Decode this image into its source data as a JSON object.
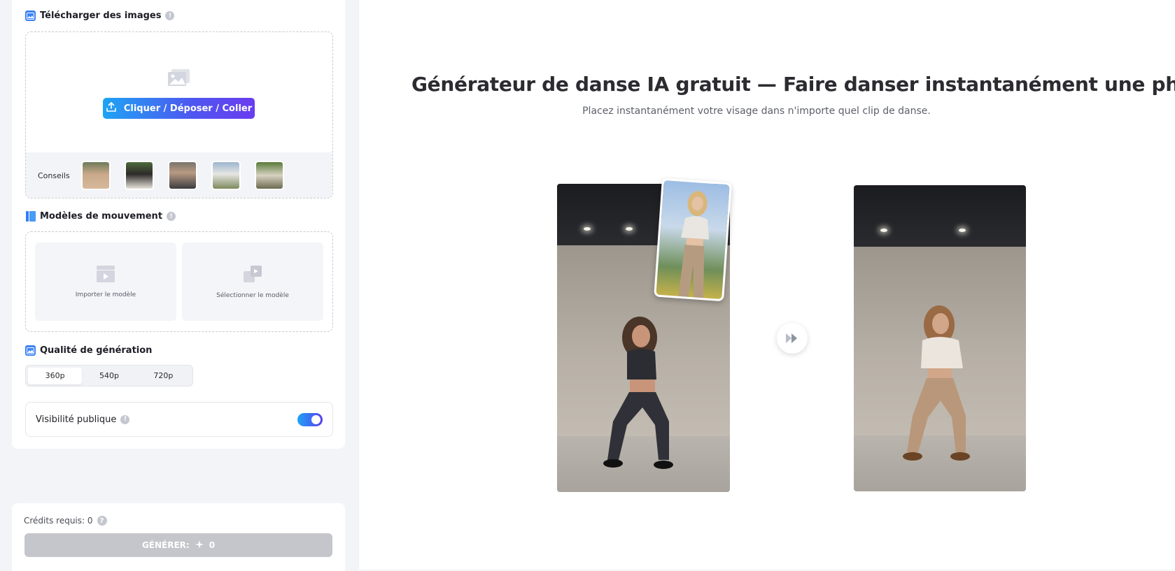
{
  "upload": {
    "title": "Télécharger des images",
    "button_label": "Cliquer / Déposer / Coller",
    "tips_label": "Conseils",
    "tip_thumbnails": [
      "tip-photo-1",
      "tip-photo-2",
      "tip-photo-3",
      "tip-photo-4",
      "tip-photo-5"
    ]
  },
  "motion": {
    "title": "Modèles de mouvement",
    "import_label": "Importer le modèle",
    "select_label": "Sélectionner le modèle"
  },
  "quality": {
    "title": "Qualité de génération",
    "options": [
      "360p",
      "540p",
      "720p"
    ],
    "selected": "360p"
  },
  "visibility": {
    "label": "Visibilité publique",
    "enabled": true
  },
  "credits": {
    "label": "Crédits requis: 0"
  },
  "generate": {
    "label": "GÉNÉRER:",
    "cost": "0"
  },
  "hero": {
    "title": "Générateur de danse IA gratuit — Faire danser instantanément une photo",
    "subtitle": "Placez instantanément votre visage dans n'importe quel clip de danse."
  },
  "colors": {
    "accent_start": "#1ea3f4",
    "accent_end": "#6a3cf0",
    "disabled_button": "#c5c6cb"
  }
}
